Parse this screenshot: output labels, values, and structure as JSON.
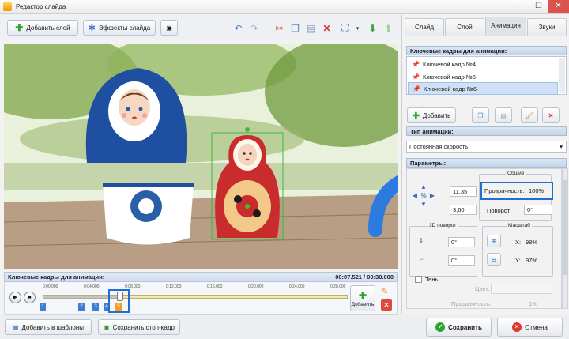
{
  "window": {
    "title": "Редактор слайда"
  },
  "toolbar": {
    "add_layer": "Добавить слой",
    "slide_effects": "Эффекты слайда"
  },
  "timeline": {
    "header": "Ключевые кадры для анимации:",
    "time_display": "00:07.521 / 00:30.000",
    "ruler_ticks": [
      "0:00.000",
      "0:04.000",
      "0:08.000",
      "0:12.000",
      "0:16.000",
      "0:20.000",
      "0:24.000",
      "0:28.000"
    ],
    "keyframes": [
      "1",
      "2",
      "3",
      "4",
      "5"
    ],
    "add_label": "Добавить"
  },
  "bottom": {
    "add_to_templates": "Добавить в шаблоны",
    "save_frame": "Сохранить стоп-кадр",
    "save": "Сохранить",
    "cancel": "Отмена"
  },
  "panel": {
    "tabs": [
      "Слайд",
      "Слой",
      "Анимация",
      "Звуки"
    ],
    "active_tab": "Анимация",
    "keyframes_header": "Ключевые кадры для анимации:",
    "keyframes": [
      "Ключевой кадр №4",
      "Ключевой кадр №5",
      "Ключевой кадр №6"
    ],
    "add_button": "Добавить",
    "anim_type_header": "Тип анимации:",
    "anim_type_value": "Постоянная скорость",
    "params_header": "Параметры:",
    "general_group": "Общие",
    "pos_x": "11,35",
    "pos_y": "3,60",
    "opacity_label": "Прозрачность:",
    "opacity_value": "100%",
    "rotation_label": "Поворот:",
    "rotation_value": "0°",
    "rot3d_group": "3D поворот",
    "rot3d_x": "0°",
    "rot3d_y": "0°",
    "scale_group": "Масштаб",
    "scale_x_label": "X:",
    "scale_x": "98%",
    "scale_y_label": "Y:",
    "scale_y": "97%",
    "shadow_label": "Тень",
    "color_label": "Цвет:",
    "shadow_opacity_label": "Прозрачность:",
    "shadow_opacity_value": "1%"
  },
  "colors": {
    "accent": "#2b72c9",
    "highlight": "#1f6fd0"
  }
}
